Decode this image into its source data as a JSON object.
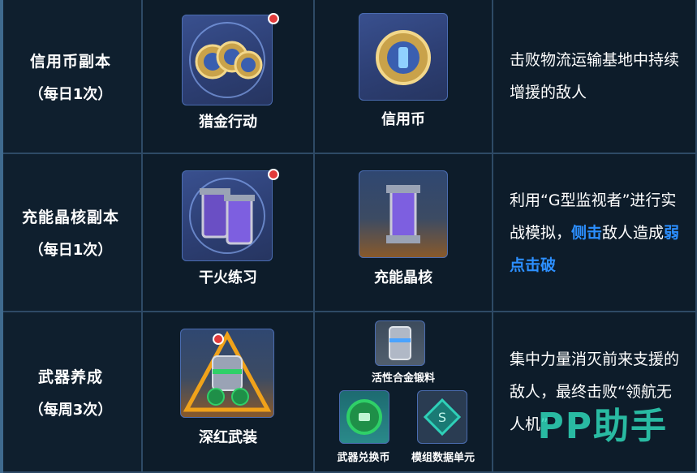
{
  "rows": [
    {
      "name": "信用币副本",
      "freq": "（每日1次）",
      "activity": {
        "label": "猎金行动",
        "icon": "gold-coins-icon"
      },
      "reward": {
        "label": "信用币",
        "icon": "credit-coin-icon"
      },
      "desc": {
        "text1": "击败物流运输基地中持续增援的敌人"
      }
    },
    {
      "name": "充能晶核副本",
      "freq": "（每日1次）",
      "activity": {
        "label": "干火练习",
        "icon": "energy-cells-icon"
      },
      "reward": {
        "label": "充能晶核",
        "icon": "energy-core-icon"
      },
      "desc": {
        "part1": "利用“G型监视者”进行实战模拟，",
        "hl1": "侧击",
        "part2": "敌人造成",
        "hl2": "弱点击破"
      }
    },
    {
      "name": "武器养成",
      "freq": "（每周3次）",
      "activity": {
        "label": "深红武装",
        "icon": "crimson-armament-icon"
      },
      "rewards": [
        {
          "label": "活性合金锻料",
          "icon": "alloy-canister-icon"
        },
        {
          "label": "武器兑换币",
          "icon": "weapon-exchange-coin-icon"
        },
        {
          "label": "模组数据单元",
          "icon": "module-data-unit-icon"
        }
      ],
      "desc": {
        "text1": "集中力量消灭前来支援的敌人，最终击败“领航无人机”"
      }
    }
  ],
  "watermark": "PP助手",
  "colors": {
    "highlight": "#2c8fff",
    "watermark": "#2fd6b8",
    "grid": "#2e4a66"
  }
}
